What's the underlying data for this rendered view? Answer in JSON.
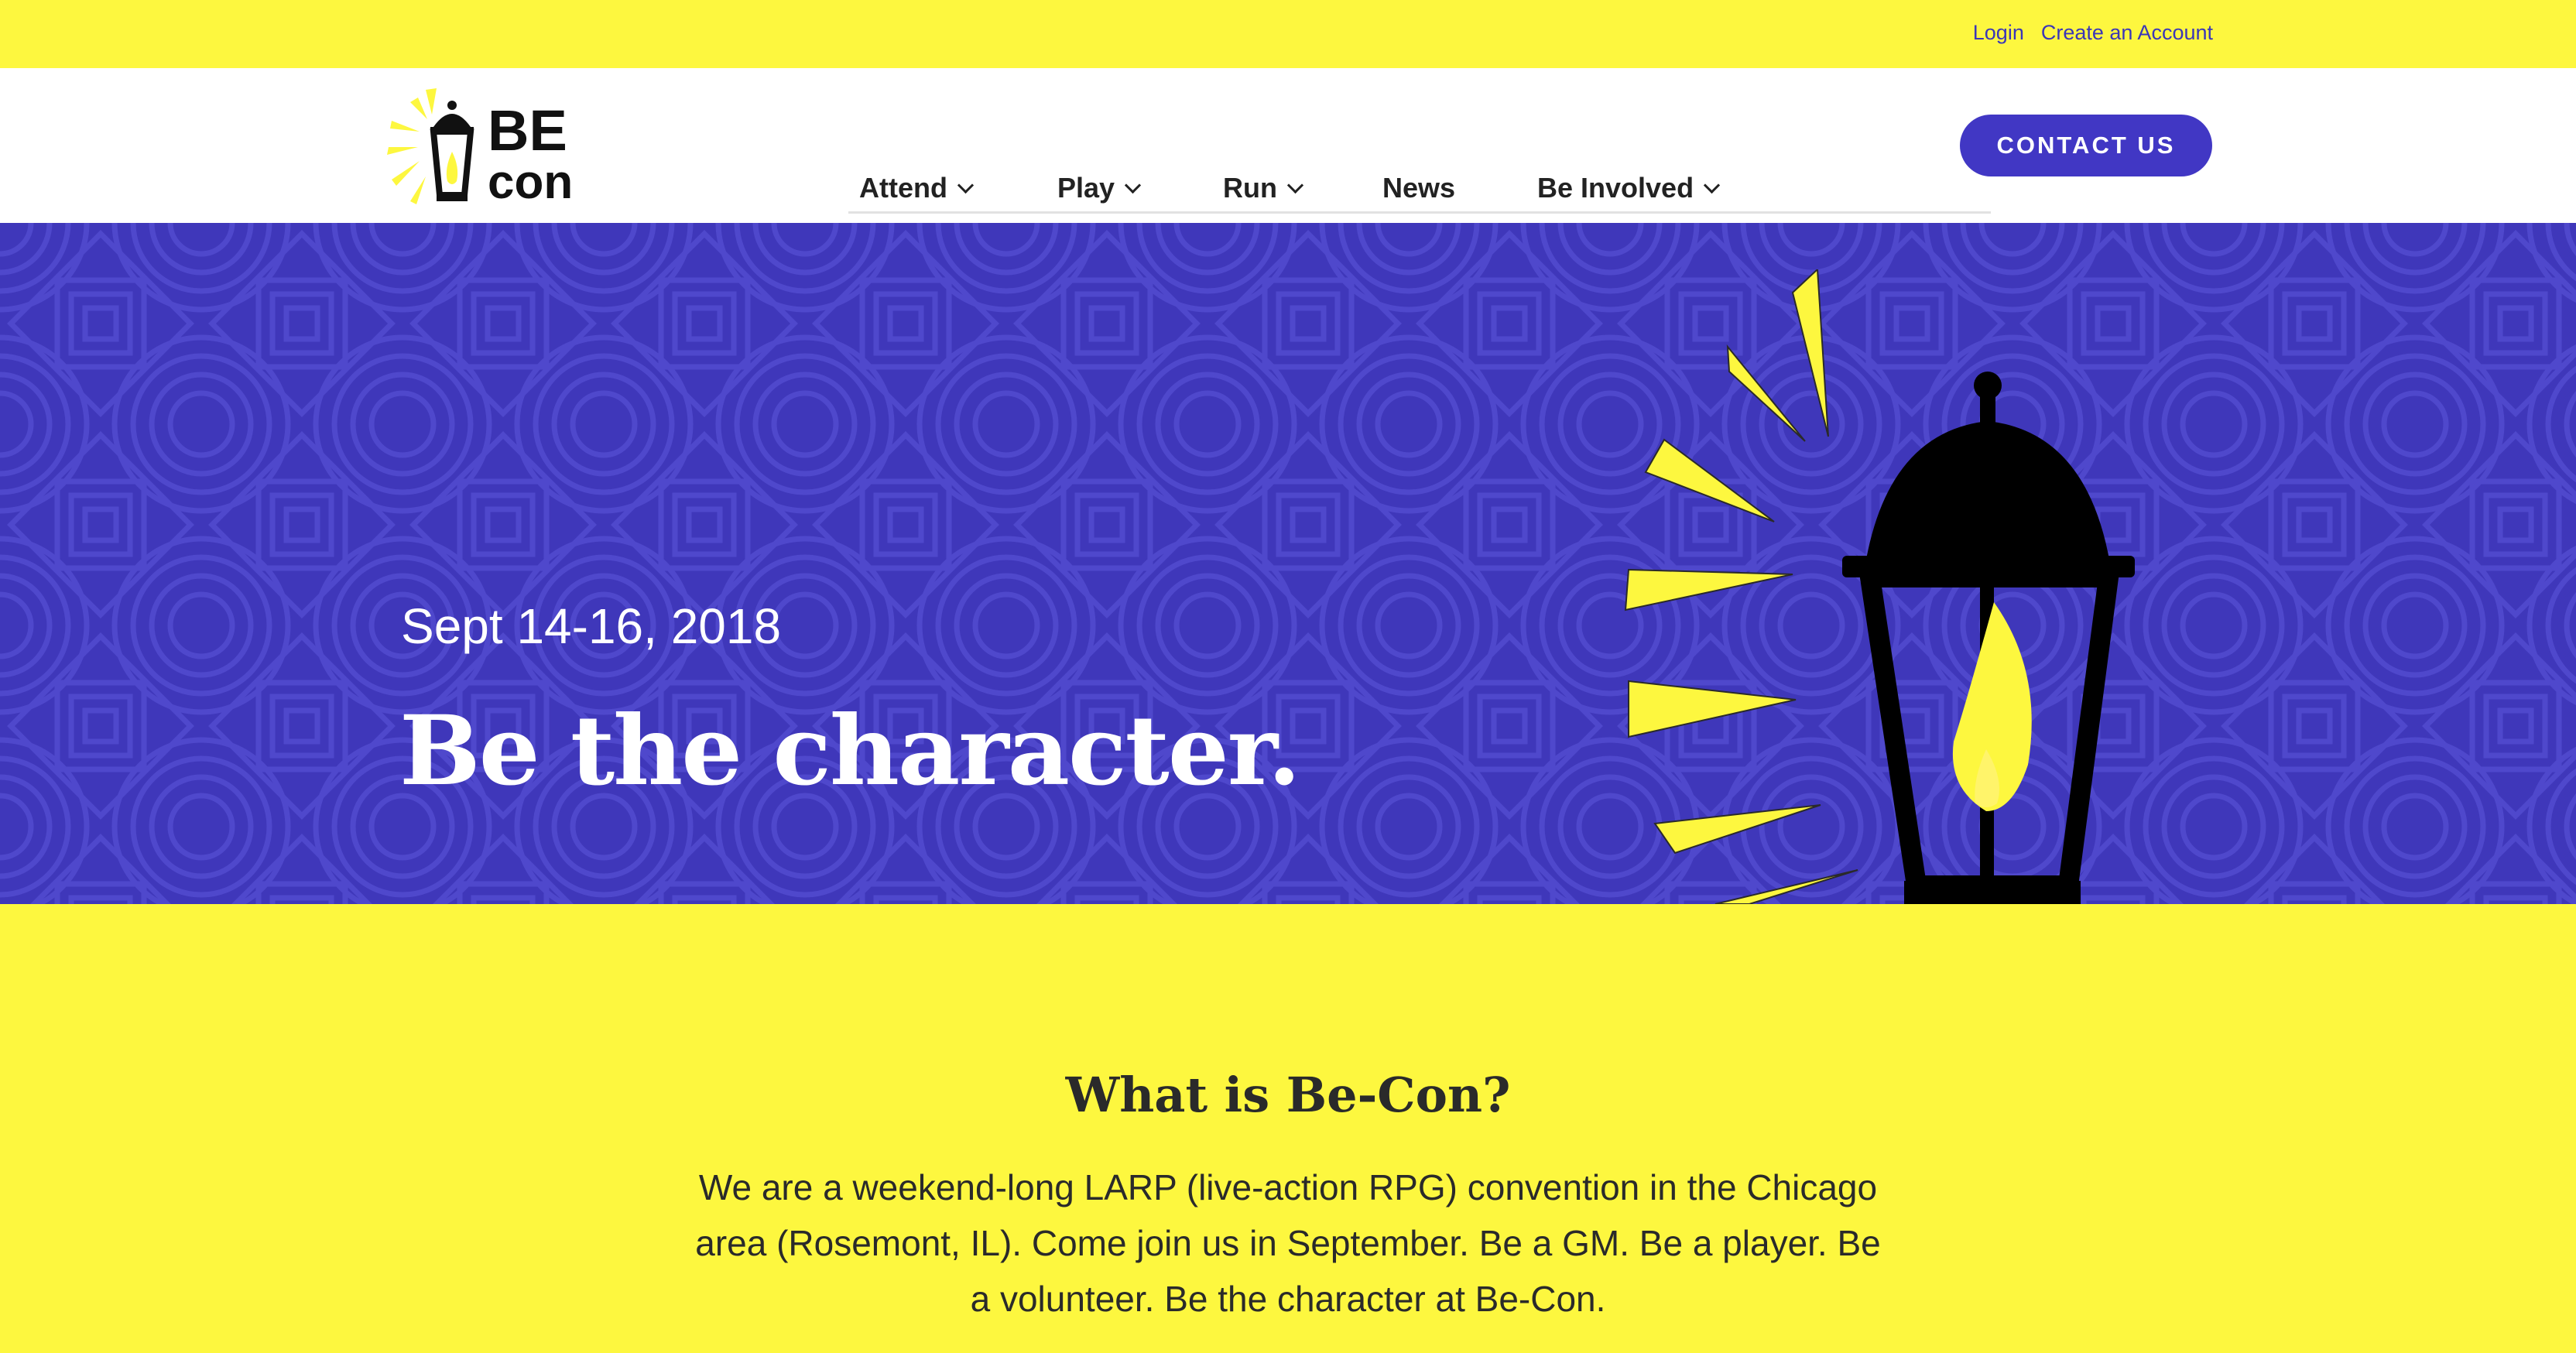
{
  "util": {
    "login": "Login",
    "create_account": "Create an Account"
  },
  "logo": {
    "line1": "BE",
    "line2": "con"
  },
  "nav": [
    {
      "label": "Attend",
      "has_dropdown": true
    },
    {
      "label": "Play",
      "has_dropdown": true
    },
    {
      "label": "Run",
      "has_dropdown": true
    },
    {
      "label": "News",
      "has_dropdown": false
    },
    {
      "label": "Be Involved",
      "has_dropdown": true
    }
  ],
  "contact_button": "CONTACT US",
  "hero": {
    "date": "Sept 14-16, 2018",
    "title": "Be the character."
  },
  "about": {
    "title": "What is Be-Con?",
    "body": "We are a weekend-long LARP (live-action RPG) convention in the Chicago area (Rosemont, IL). Come join us in September. Be a GM. Be a player. Be a volunteer. Be the character at Be-Con."
  },
  "colors": {
    "yellow": "#fdf73f",
    "indigo": "#3f37ba",
    "button": "#4137c4",
    "link": "#3b36b8"
  },
  "icons": [
    "lantern-logo-icon",
    "chevron-down-icon",
    "lantern-illustration-icon",
    "light-ray-icon"
  ]
}
